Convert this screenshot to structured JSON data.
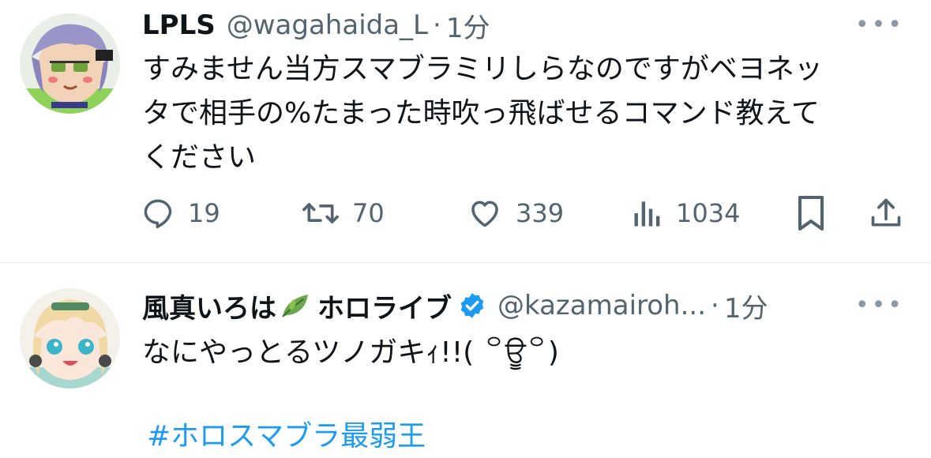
{
  "tweets": [
    {
      "display_name": "LPLS",
      "handle": "@wagahaida_L",
      "separator": "·",
      "time": "1分",
      "more": "•••",
      "text_lines": [
        "すみません当方スマブラミリしらなのですがベヨネッ",
        "タで相手の%たまった時吹っ飛ばせるコマンド教えて",
        "ください"
      ],
      "actions": {
        "replies": "19",
        "retweets": "70",
        "likes": "339",
        "views": "1034"
      }
    },
    {
      "display_name": "風真いろは",
      "display_name_suffix": "ホロライブ",
      "handle": "@kazamairoh...",
      "separator": "·",
      "time": "1分",
      "more": "•••",
      "verified": true,
      "text": "なにやっとるツノガキｨ!!( ꒪ਊ꒪)",
      "hashtag": "#ホロスマブラ最弱王"
    }
  ],
  "icons": {
    "reply": "reply-icon",
    "retweet": "retweet-icon",
    "like": "heart-icon",
    "views": "views-icon",
    "bookmark": "bookmark-icon",
    "share": "share-icon",
    "leaf": "leaf-icon",
    "verified": "verified-badge-icon"
  },
  "colors": {
    "text": "#0f1419",
    "secondary": "#536471",
    "link": "#1d9bf0",
    "divider": "#e6e9ec"
  }
}
